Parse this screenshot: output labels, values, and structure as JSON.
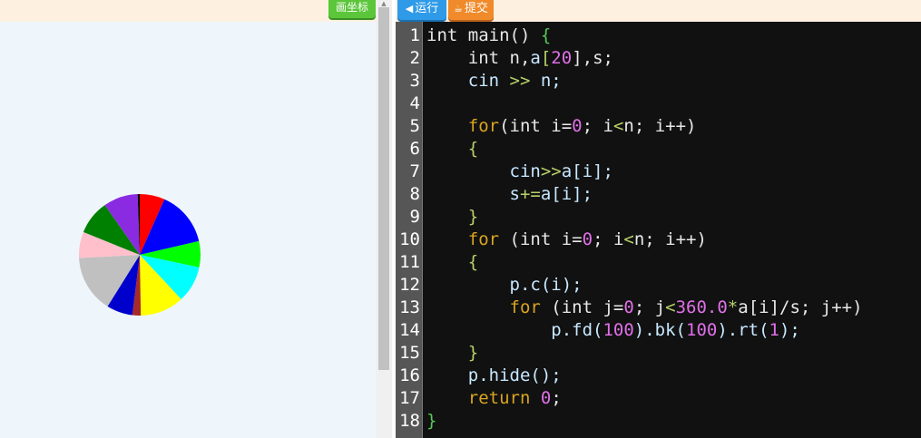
{
  "toolbar": {
    "draw_coords_label": "画坐标",
    "run_label": "运行",
    "run_icon": "◀",
    "submit_label": "提交",
    "submit_icon": "☕"
  },
  "pie": {
    "slices": [
      {
        "color": "#ff0000",
        "degrees": 24
      },
      {
        "color": "#0000ff",
        "degrees": 53
      },
      {
        "color": "#00ff00",
        "degrees": 25
      },
      {
        "color": "#00ffff",
        "degrees": 35
      },
      {
        "color": "#ffff00",
        "degrees": 42
      },
      {
        "color": "#a52a2a",
        "degrees": 8
      },
      {
        "color": "#0000cd",
        "degrees": 25
      },
      {
        "color": "#c0c0c0",
        "degrees": 55
      },
      {
        "color": "#ffc0cb",
        "degrees": 25
      },
      {
        "color": "#008000",
        "degrees": 33
      },
      {
        "color": "#8a2be2",
        "degrees": 33
      },
      {
        "color": "#000000",
        "degrees": 2
      }
    ]
  },
  "code": {
    "lines": [
      [
        [
          "int main() ",
          "kw"
        ],
        [
          "{",
          "br"
        ]
      ],
      [
        [
          "    int n,",
          "kw"
        ],
        [
          "a",
          "id"
        ],
        [
          "[",
          "op"
        ],
        [
          "20",
          "num"
        ],
        [
          "],s;",
          "kw"
        ]
      ],
      [
        [
          "    cin ",
          "id"
        ],
        [
          ">>",
          "op"
        ],
        [
          " n;",
          "id"
        ]
      ],
      [
        [
          "",
          ""
        ]
      ],
      [
        [
          "    ",
          "kw"
        ],
        [
          "for",
          "ctrl"
        ],
        [
          "(int i=",
          "kw"
        ],
        [
          "0",
          "num"
        ],
        [
          "; i",
          "kw"
        ],
        [
          "<",
          "op"
        ],
        [
          "n; i++)",
          "kw"
        ]
      ],
      [
        [
          "    ",
          "kw"
        ],
        [
          "{",
          "op"
        ]
      ],
      [
        [
          "        cin",
          "id"
        ],
        [
          ">>",
          "op"
        ],
        [
          "a[i];",
          "id"
        ]
      ],
      [
        [
          "        s",
          "id"
        ],
        [
          "+=",
          "op"
        ],
        [
          "a[i];",
          "id"
        ]
      ],
      [
        [
          "    ",
          "kw"
        ],
        [
          "}",
          "op"
        ]
      ],
      [
        [
          "    ",
          "kw"
        ],
        [
          "for",
          "ctrl"
        ],
        [
          " (int i=",
          "kw"
        ],
        [
          "0",
          "num"
        ],
        [
          "; i",
          "kw"
        ],
        [
          "<",
          "op"
        ],
        [
          "n; i++)",
          "kw"
        ]
      ],
      [
        [
          "    ",
          "kw"
        ],
        [
          "{",
          "op"
        ]
      ],
      [
        [
          "        p.c(i);",
          "id"
        ]
      ],
      [
        [
          "        ",
          "kw"
        ],
        [
          "for",
          "ctrl"
        ],
        [
          " (int j=",
          "kw"
        ],
        [
          "0",
          "num"
        ],
        [
          "; j",
          "kw"
        ],
        [
          "<",
          "op"
        ],
        [
          "360.0",
          "num"
        ],
        [
          "*",
          "op"
        ],
        [
          "a[i]/s; j++)",
          "kw"
        ]
      ],
      [
        [
          "            p.fd(",
          "id"
        ],
        [
          "100",
          "num"
        ],
        [
          ").bk(",
          "id"
        ],
        [
          "100",
          "num"
        ],
        [
          ").rt(",
          "id"
        ],
        [
          "1",
          "num"
        ],
        [
          ");",
          "id"
        ]
      ],
      [
        [
          "    ",
          "kw"
        ],
        [
          "}",
          "op"
        ]
      ],
      [
        [
          "    p.hide();",
          "id"
        ]
      ],
      [
        [
          "    ",
          "kw"
        ],
        [
          "return",
          "ctrl"
        ],
        [
          " ",
          "kw"
        ],
        [
          "0",
          "num"
        ],
        [
          ";",
          "kw"
        ]
      ],
      [
        [
          "}",
          "br"
        ]
      ]
    ]
  }
}
